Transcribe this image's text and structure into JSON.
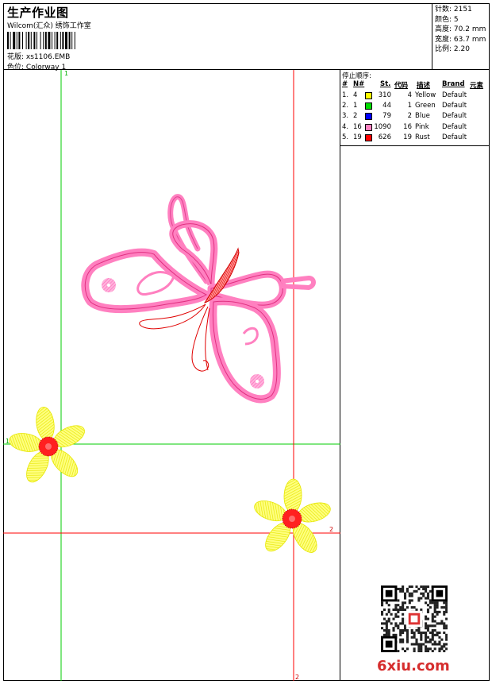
{
  "header": {
    "title": "生产作业图",
    "company": "Wilcom(汇众) 绣饰工作室",
    "design_label": "花版:",
    "design_value": "xs1106.EMB",
    "colorway_label": "色位:",
    "colorway_value": "Colorway 1"
  },
  "stats": [
    {
      "label": "针数:",
      "value": "2151"
    },
    {
      "label": "颜色:",
      "value": "5"
    },
    {
      "label": "高度:",
      "value": "70.2 mm"
    },
    {
      "label": "宽度:",
      "value": "63.7 mm"
    },
    {
      "label": "比例:",
      "value": "2.20"
    }
  ],
  "stop_sequence": {
    "label": "停止顺序:",
    "headers": {
      "idx": "#",
      "n": "N#",
      "st": "St.",
      "code": "代码",
      "desc": "描述",
      "brand": "Brand",
      "elem": "元素"
    },
    "rows": [
      {
        "idx": "1.",
        "n": "4",
        "color": "#ffff00",
        "st": "310",
        "code": "4",
        "desc": "Yellow",
        "brand": "Default"
      },
      {
        "idx": "2.",
        "n": "1",
        "color": "#00dd00",
        "st": "44",
        "code": "1",
        "desc": "Green",
        "brand": "Default"
      },
      {
        "idx": "3.",
        "n": "2",
        "color": "#0000ff",
        "st": "79",
        "code": "2",
        "desc": "Blue",
        "brand": "Default"
      },
      {
        "idx": "4.",
        "n": "16",
        "color": "#ff80c0",
        "st": "1090",
        "code": "16",
        "desc": "Pink",
        "brand": "Default"
      },
      {
        "idx": "5.",
        "n": "19",
        "color": "#ff0000",
        "st": "626",
        "code": "19",
        "desc": "Rust",
        "brand": "Default"
      }
    ]
  },
  "guides": {
    "green_1": "1",
    "green_2": "1",
    "red_1": "2",
    "red_2": "2"
  },
  "watermark": "6xiu.com"
}
